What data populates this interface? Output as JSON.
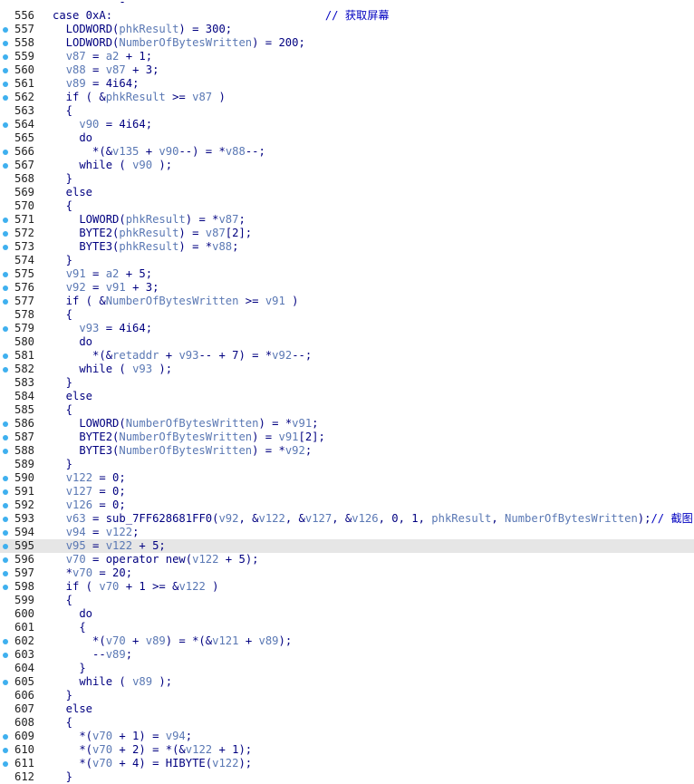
{
  "colors": {
    "breakpoint": "#3fb0ef",
    "keyword": "#000080",
    "variable": "#5a78b4",
    "comment": "#0000c0",
    "highlight": "#e6e6e6"
  },
  "lines": [
    {
      "n": "",
      "bp": false,
      "hl": false,
      "tokens": [
        {
          "t": "  ",
          "c": "n"
        },
        {
          "t": "        -",
          "c": "n"
        }
      ]
    },
    {
      "n": "556",
      "bp": false,
      "hl": false,
      "tokens": [
        {
          "t": "case 0xA:",
          "c": "n"
        },
        {
          "t": "                                // 获取屏幕",
          "c": "c"
        }
      ]
    },
    {
      "n": "557",
      "bp": true,
      "hl": false,
      "tokens": [
        {
          "t": "  LODWORD(",
          "c": "n"
        },
        {
          "t": "phkResult",
          "c": "v"
        },
        {
          "t": ") = 300;",
          "c": "n"
        }
      ]
    },
    {
      "n": "558",
      "bp": true,
      "hl": false,
      "tokens": [
        {
          "t": "  LODWORD(",
          "c": "n"
        },
        {
          "t": "NumberOfBytesWritten",
          "c": "v"
        },
        {
          "t": ") = 200;",
          "c": "n"
        }
      ]
    },
    {
      "n": "559",
      "bp": true,
      "hl": false,
      "tokens": [
        {
          "t": "  ",
          "c": "n"
        },
        {
          "t": "v87",
          "c": "v"
        },
        {
          "t": " = ",
          "c": "n"
        },
        {
          "t": "a2",
          "c": "v"
        },
        {
          "t": " + 1;",
          "c": "n"
        }
      ]
    },
    {
      "n": "560",
      "bp": true,
      "hl": false,
      "tokens": [
        {
          "t": "  ",
          "c": "n"
        },
        {
          "t": "v88",
          "c": "v"
        },
        {
          "t": " = ",
          "c": "n"
        },
        {
          "t": "v87",
          "c": "v"
        },
        {
          "t": " + 3;",
          "c": "n"
        }
      ]
    },
    {
      "n": "561",
      "bp": true,
      "hl": false,
      "tokens": [
        {
          "t": "  ",
          "c": "n"
        },
        {
          "t": "v89",
          "c": "v"
        },
        {
          "t": " = 4i64;",
          "c": "n"
        }
      ]
    },
    {
      "n": "562",
      "bp": true,
      "hl": false,
      "tokens": [
        {
          "t": "  if ( &",
          "c": "n"
        },
        {
          "t": "phkResult",
          "c": "v"
        },
        {
          "t": " >= ",
          "c": "n"
        },
        {
          "t": "v87",
          "c": "v"
        },
        {
          "t": " )",
          "c": "n"
        }
      ]
    },
    {
      "n": "563",
      "bp": false,
      "hl": false,
      "tokens": [
        {
          "t": "  {",
          "c": "n"
        }
      ]
    },
    {
      "n": "564",
      "bp": true,
      "hl": false,
      "tokens": [
        {
          "t": "    ",
          "c": "n"
        },
        {
          "t": "v90",
          "c": "v"
        },
        {
          "t": " = 4i64;",
          "c": "n"
        }
      ]
    },
    {
      "n": "565",
      "bp": false,
      "hl": false,
      "tokens": [
        {
          "t": "    do",
          "c": "n"
        }
      ]
    },
    {
      "n": "566",
      "bp": true,
      "hl": false,
      "tokens": [
        {
          "t": "      *(&",
          "c": "n"
        },
        {
          "t": "v135",
          "c": "v"
        },
        {
          "t": " + ",
          "c": "n"
        },
        {
          "t": "v90",
          "c": "v"
        },
        {
          "t": "--) = *",
          "c": "n"
        },
        {
          "t": "v88",
          "c": "v"
        },
        {
          "t": "--;",
          "c": "n"
        }
      ]
    },
    {
      "n": "567",
      "bp": true,
      "hl": false,
      "tokens": [
        {
          "t": "    while ( ",
          "c": "n"
        },
        {
          "t": "v90",
          "c": "v"
        },
        {
          "t": " );",
          "c": "n"
        }
      ]
    },
    {
      "n": "568",
      "bp": false,
      "hl": false,
      "tokens": [
        {
          "t": "  }",
          "c": "n"
        }
      ]
    },
    {
      "n": "569",
      "bp": false,
      "hl": false,
      "tokens": [
        {
          "t": "  else",
          "c": "n"
        }
      ]
    },
    {
      "n": "570",
      "bp": false,
      "hl": false,
      "tokens": [
        {
          "t": "  {",
          "c": "n"
        }
      ]
    },
    {
      "n": "571",
      "bp": true,
      "hl": false,
      "tokens": [
        {
          "t": "    LOWORD(",
          "c": "n"
        },
        {
          "t": "phkResult",
          "c": "v"
        },
        {
          "t": ") = *",
          "c": "n"
        },
        {
          "t": "v87",
          "c": "v"
        },
        {
          "t": ";",
          "c": "n"
        }
      ]
    },
    {
      "n": "572",
      "bp": true,
      "hl": false,
      "tokens": [
        {
          "t": "    BYTE2(",
          "c": "n"
        },
        {
          "t": "phkResult",
          "c": "v"
        },
        {
          "t": ") = ",
          "c": "n"
        },
        {
          "t": "v87",
          "c": "v"
        },
        {
          "t": "[2];",
          "c": "n"
        }
      ]
    },
    {
      "n": "573",
      "bp": true,
      "hl": false,
      "tokens": [
        {
          "t": "    BYTE3(",
          "c": "n"
        },
        {
          "t": "phkResult",
          "c": "v"
        },
        {
          "t": ") = *",
          "c": "n"
        },
        {
          "t": "v88",
          "c": "v"
        },
        {
          "t": ";",
          "c": "n"
        }
      ]
    },
    {
      "n": "574",
      "bp": false,
      "hl": false,
      "tokens": [
        {
          "t": "  }",
          "c": "n"
        }
      ]
    },
    {
      "n": "575",
      "bp": true,
      "hl": false,
      "tokens": [
        {
          "t": "  ",
          "c": "n"
        },
        {
          "t": "v91",
          "c": "v"
        },
        {
          "t": " = ",
          "c": "n"
        },
        {
          "t": "a2",
          "c": "v"
        },
        {
          "t": " + 5;",
          "c": "n"
        }
      ]
    },
    {
      "n": "576",
      "bp": true,
      "hl": false,
      "tokens": [
        {
          "t": "  ",
          "c": "n"
        },
        {
          "t": "v92",
          "c": "v"
        },
        {
          "t": " = ",
          "c": "n"
        },
        {
          "t": "v91",
          "c": "v"
        },
        {
          "t": " + 3;",
          "c": "n"
        }
      ]
    },
    {
      "n": "577",
      "bp": true,
      "hl": false,
      "tokens": [
        {
          "t": "  if ( &",
          "c": "n"
        },
        {
          "t": "NumberOfBytesWritten",
          "c": "v"
        },
        {
          "t": " >= ",
          "c": "n"
        },
        {
          "t": "v91",
          "c": "v"
        },
        {
          "t": " )",
          "c": "n"
        }
      ]
    },
    {
      "n": "578",
      "bp": false,
      "hl": false,
      "tokens": [
        {
          "t": "  {",
          "c": "n"
        }
      ]
    },
    {
      "n": "579",
      "bp": true,
      "hl": false,
      "tokens": [
        {
          "t": "    ",
          "c": "n"
        },
        {
          "t": "v93",
          "c": "v"
        },
        {
          "t": " = 4i64;",
          "c": "n"
        }
      ]
    },
    {
      "n": "580",
      "bp": false,
      "hl": false,
      "tokens": [
        {
          "t": "    do",
          "c": "n"
        }
      ]
    },
    {
      "n": "581",
      "bp": true,
      "hl": false,
      "tokens": [
        {
          "t": "      *(&",
          "c": "n"
        },
        {
          "t": "retaddr",
          "c": "v"
        },
        {
          "t": " + ",
          "c": "n"
        },
        {
          "t": "v93",
          "c": "v"
        },
        {
          "t": "-- + 7) = *",
          "c": "n"
        },
        {
          "t": "v92",
          "c": "v"
        },
        {
          "t": "--;",
          "c": "n"
        }
      ]
    },
    {
      "n": "582",
      "bp": true,
      "hl": false,
      "tokens": [
        {
          "t": "    while ( ",
          "c": "n"
        },
        {
          "t": "v93",
          "c": "v"
        },
        {
          "t": " );",
          "c": "n"
        }
      ]
    },
    {
      "n": "583",
      "bp": false,
      "hl": false,
      "tokens": [
        {
          "t": "  }",
          "c": "n"
        }
      ]
    },
    {
      "n": "584",
      "bp": false,
      "hl": false,
      "tokens": [
        {
          "t": "  else",
          "c": "n"
        }
      ]
    },
    {
      "n": "585",
      "bp": false,
      "hl": false,
      "tokens": [
        {
          "t": "  {",
          "c": "n"
        }
      ]
    },
    {
      "n": "586",
      "bp": true,
      "hl": false,
      "tokens": [
        {
          "t": "    LOWORD(",
          "c": "n"
        },
        {
          "t": "NumberOfBytesWritten",
          "c": "v"
        },
        {
          "t": ") = *",
          "c": "n"
        },
        {
          "t": "v91",
          "c": "v"
        },
        {
          "t": ";",
          "c": "n"
        }
      ]
    },
    {
      "n": "587",
      "bp": true,
      "hl": false,
      "tokens": [
        {
          "t": "    BYTE2(",
          "c": "n"
        },
        {
          "t": "NumberOfBytesWritten",
          "c": "v"
        },
        {
          "t": ") = ",
          "c": "n"
        },
        {
          "t": "v91",
          "c": "v"
        },
        {
          "t": "[2];",
          "c": "n"
        }
      ]
    },
    {
      "n": "588",
      "bp": true,
      "hl": false,
      "tokens": [
        {
          "t": "    BYTE3(",
          "c": "n"
        },
        {
          "t": "NumberOfBytesWritten",
          "c": "v"
        },
        {
          "t": ") = *",
          "c": "n"
        },
        {
          "t": "v92",
          "c": "v"
        },
        {
          "t": ";",
          "c": "n"
        }
      ]
    },
    {
      "n": "589",
      "bp": false,
      "hl": false,
      "tokens": [
        {
          "t": "  }",
          "c": "n"
        }
      ]
    },
    {
      "n": "590",
      "bp": true,
      "hl": false,
      "tokens": [
        {
          "t": "  ",
          "c": "n"
        },
        {
          "t": "v122",
          "c": "v"
        },
        {
          "t": " = 0;",
          "c": "n"
        }
      ]
    },
    {
      "n": "591",
      "bp": true,
      "hl": false,
      "tokens": [
        {
          "t": "  ",
          "c": "n"
        },
        {
          "t": "v127",
          "c": "v"
        },
        {
          "t": " = 0;",
          "c": "n"
        }
      ]
    },
    {
      "n": "592",
      "bp": true,
      "hl": false,
      "tokens": [
        {
          "t": "  ",
          "c": "n"
        },
        {
          "t": "v126",
          "c": "v"
        },
        {
          "t": " = 0;",
          "c": "n"
        }
      ]
    },
    {
      "n": "593",
      "bp": true,
      "hl": false,
      "tokens": [
        {
          "t": "  ",
          "c": "n"
        },
        {
          "t": "v63",
          "c": "v"
        },
        {
          "t": " = sub_7FF628681FF0(",
          "c": "n"
        },
        {
          "t": "v92",
          "c": "v"
        },
        {
          "t": ", &",
          "c": "n"
        },
        {
          "t": "v122",
          "c": "v"
        },
        {
          "t": ", &",
          "c": "n"
        },
        {
          "t": "v127",
          "c": "v"
        },
        {
          "t": ", &",
          "c": "n"
        },
        {
          "t": "v126",
          "c": "v"
        },
        {
          "t": ", 0, 1, ",
          "c": "n"
        },
        {
          "t": "phkResult",
          "c": "v"
        },
        {
          "t": ", ",
          "c": "n"
        },
        {
          "t": "NumberOfBytesWritten",
          "c": "v"
        },
        {
          "t": ");",
          "c": "n"
        },
        {
          "t": "// 截图",
          "c": "c"
        }
      ]
    },
    {
      "n": "594",
      "bp": true,
      "hl": false,
      "tokens": [
        {
          "t": "  ",
          "c": "n"
        },
        {
          "t": "v94",
          "c": "v"
        },
        {
          "t": " = ",
          "c": "n"
        },
        {
          "t": "v122",
          "c": "v"
        },
        {
          "t": ";",
          "c": "n"
        }
      ]
    },
    {
      "n": "595",
      "bp": true,
      "hl": true,
      "tokens": [
        {
          "t": "  ",
          "c": "n"
        },
        {
          "t": "v95",
          "c": "v"
        },
        {
          "t": " = ",
          "c": "n"
        },
        {
          "t": "v122",
          "c": "v"
        },
        {
          "t": " + 5;",
          "c": "n"
        }
      ]
    },
    {
      "n": "596",
      "bp": true,
      "hl": false,
      "tokens": [
        {
          "t": "  ",
          "c": "n"
        },
        {
          "t": "v70",
          "c": "v"
        },
        {
          "t": " = operator new(",
          "c": "n"
        },
        {
          "t": "v122",
          "c": "v"
        },
        {
          "t": " + 5);",
          "c": "n"
        }
      ]
    },
    {
      "n": "597",
      "bp": true,
      "hl": false,
      "tokens": [
        {
          "t": "  *",
          "c": "n"
        },
        {
          "t": "v70",
          "c": "v"
        },
        {
          "t": " = 20;",
          "c": "n"
        }
      ]
    },
    {
      "n": "598",
      "bp": true,
      "hl": false,
      "tokens": [
        {
          "t": "  if ( ",
          "c": "n"
        },
        {
          "t": "v70",
          "c": "v"
        },
        {
          "t": " + 1 >= &",
          "c": "n"
        },
        {
          "t": "v122",
          "c": "v"
        },
        {
          "t": " )",
          "c": "n"
        }
      ]
    },
    {
      "n": "599",
      "bp": false,
      "hl": false,
      "tokens": [
        {
          "t": "  {",
          "c": "n"
        }
      ]
    },
    {
      "n": "600",
      "bp": false,
      "hl": false,
      "tokens": [
        {
          "t": "    do",
          "c": "n"
        }
      ]
    },
    {
      "n": "601",
      "bp": false,
      "hl": false,
      "tokens": [
        {
          "t": "    {",
          "c": "n"
        }
      ]
    },
    {
      "n": "602",
      "bp": true,
      "hl": false,
      "tokens": [
        {
          "t": "      *(",
          "c": "n"
        },
        {
          "t": "v70",
          "c": "v"
        },
        {
          "t": " + ",
          "c": "n"
        },
        {
          "t": "v89",
          "c": "v"
        },
        {
          "t": ") = *(&",
          "c": "n"
        },
        {
          "t": "v121",
          "c": "v"
        },
        {
          "t": " + ",
          "c": "n"
        },
        {
          "t": "v89",
          "c": "v"
        },
        {
          "t": ");",
          "c": "n"
        }
      ]
    },
    {
      "n": "603",
      "bp": true,
      "hl": false,
      "tokens": [
        {
          "t": "      --",
          "c": "n"
        },
        {
          "t": "v89",
          "c": "v"
        },
        {
          "t": ";",
          "c": "n"
        }
      ]
    },
    {
      "n": "604",
      "bp": false,
      "hl": false,
      "tokens": [
        {
          "t": "    }",
          "c": "n"
        }
      ]
    },
    {
      "n": "605",
      "bp": true,
      "hl": false,
      "tokens": [
        {
          "t": "    while ( ",
          "c": "n"
        },
        {
          "t": "v89",
          "c": "v"
        },
        {
          "t": " );",
          "c": "n"
        }
      ]
    },
    {
      "n": "606",
      "bp": false,
      "hl": false,
      "tokens": [
        {
          "t": "  }",
          "c": "n"
        }
      ]
    },
    {
      "n": "607",
      "bp": false,
      "hl": false,
      "tokens": [
        {
          "t": "  else",
          "c": "n"
        }
      ]
    },
    {
      "n": "608",
      "bp": false,
      "hl": false,
      "tokens": [
        {
          "t": "  {",
          "c": "n"
        }
      ]
    },
    {
      "n": "609",
      "bp": true,
      "hl": false,
      "tokens": [
        {
          "t": "    *(",
          "c": "n"
        },
        {
          "t": "v70",
          "c": "v"
        },
        {
          "t": " + 1) = ",
          "c": "n"
        },
        {
          "t": "v94",
          "c": "v"
        },
        {
          "t": ";",
          "c": "n"
        }
      ]
    },
    {
      "n": "610",
      "bp": true,
      "hl": false,
      "tokens": [
        {
          "t": "    *(",
          "c": "n"
        },
        {
          "t": "v70",
          "c": "v"
        },
        {
          "t": " + 2) = *(&",
          "c": "n"
        },
        {
          "t": "v122",
          "c": "v"
        },
        {
          "t": " + 1);",
          "c": "n"
        }
      ]
    },
    {
      "n": "611",
      "bp": true,
      "hl": false,
      "tokens": [
        {
          "t": "    *(",
          "c": "n"
        },
        {
          "t": "v70",
          "c": "v"
        },
        {
          "t": " + 4) = HIBYTE(",
          "c": "n"
        },
        {
          "t": "v122",
          "c": "v"
        },
        {
          "t": ");",
          "c": "n"
        }
      ]
    },
    {
      "n": "612",
      "bp": false,
      "hl": false,
      "tokens": [
        {
          "t": "  }",
          "c": "n"
        }
      ]
    }
  ]
}
